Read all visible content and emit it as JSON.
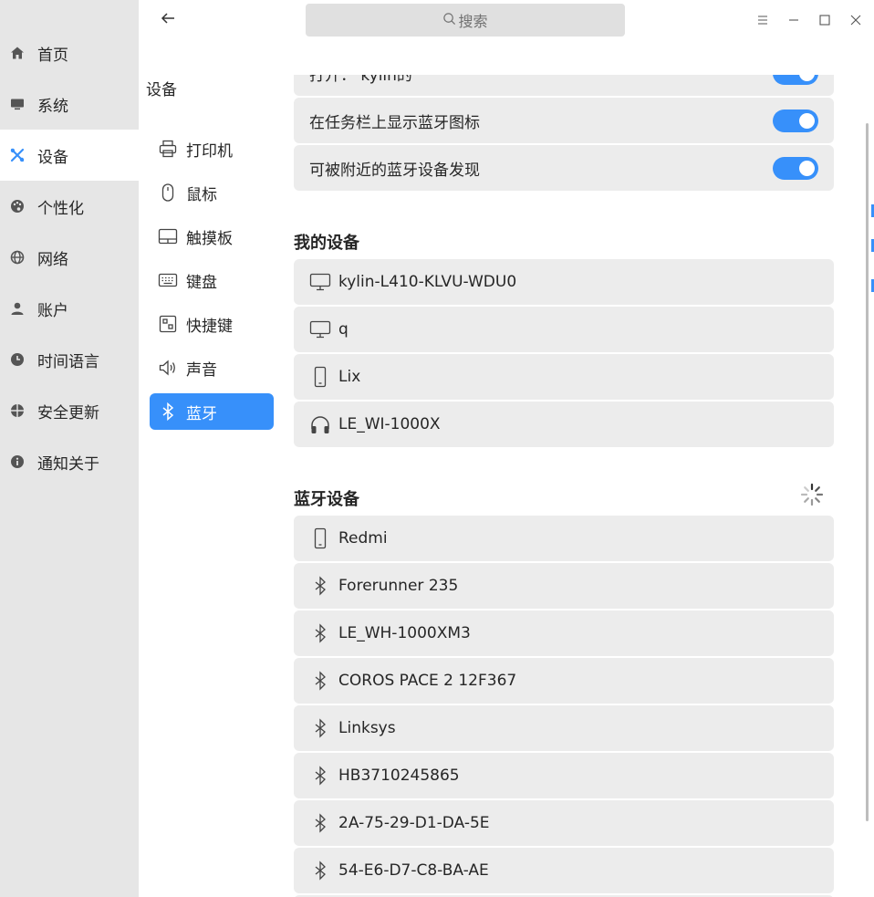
{
  "colors": {
    "accent": "#3790fa",
    "sidebar_bg": "#e6e6e6",
    "row_bg": "#ececec"
  },
  "sidebar": {
    "items": [
      {
        "label": "首页",
        "icon": "home-icon"
      },
      {
        "label": "系统",
        "icon": "monitor-icon"
      },
      {
        "label": "设备",
        "icon": "devices-icon",
        "active": true
      },
      {
        "label": "个性化",
        "icon": "palette-icon"
      },
      {
        "label": "网络",
        "icon": "globe-icon"
      },
      {
        "label": "账户",
        "icon": "user-icon"
      },
      {
        "label": "时间语言",
        "icon": "clock-icon"
      },
      {
        "label": "安全更新",
        "icon": "shield-icon"
      },
      {
        "label": "通知关于",
        "icon": "info-icon"
      }
    ]
  },
  "search": {
    "placeholder": "搜索",
    "icon": "search-icon"
  },
  "subnav": {
    "title": "设备",
    "items": [
      {
        "label": "打印机",
        "icon": "printer-icon"
      },
      {
        "label": "鼠标",
        "icon": "mouse-icon"
      },
      {
        "label": "触摸板",
        "icon": "touchpad-icon"
      },
      {
        "label": "键盘",
        "icon": "keyboard-icon"
      },
      {
        "label": "快捷键",
        "icon": "shortcut-icon"
      },
      {
        "label": "声音",
        "icon": "speaker-icon"
      },
      {
        "label": "蓝牙",
        "icon": "bluetooth-icon",
        "active": true
      }
    ]
  },
  "settings": {
    "rows": [
      {
        "label": "打开：  kylin的",
        "enabled": true
      },
      {
        "label": "在任务栏上显示蓝牙图标",
        "enabled": true
      },
      {
        "label": "可被附近的蓝牙设备发现",
        "enabled": true
      }
    ]
  },
  "my_devices": {
    "title": "我的设备",
    "items": [
      {
        "name": "kylin-L410-KLVU-WDU0",
        "icon": "computer-icon"
      },
      {
        "name": "q",
        "icon": "computer-icon"
      },
      {
        "name": "Lix",
        "icon": "phone-icon"
      },
      {
        "name": "LE_WI-1000X",
        "icon": "headphones-icon"
      }
    ]
  },
  "bt_devices": {
    "title": "蓝牙设备",
    "items": [
      {
        "name": "Redmi",
        "icon": "phone-icon"
      },
      {
        "name": "Forerunner 235",
        "icon": "bluetooth-icon"
      },
      {
        "name": "LE_WH-1000XM3",
        "icon": "bluetooth-icon"
      },
      {
        "name": "COROS PACE 2 12F367",
        "icon": "bluetooth-icon"
      },
      {
        "name": "Linksys",
        "icon": "bluetooth-icon"
      },
      {
        "name": "HB3710245865",
        "icon": "bluetooth-icon"
      },
      {
        "name": "2A-75-29-D1-DA-5E",
        "icon": "bluetooth-icon"
      },
      {
        "name": "54-E6-D7-C8-BA-AE",
        "icon": "bluetooth-icon"
      }
    ]
  }
}
